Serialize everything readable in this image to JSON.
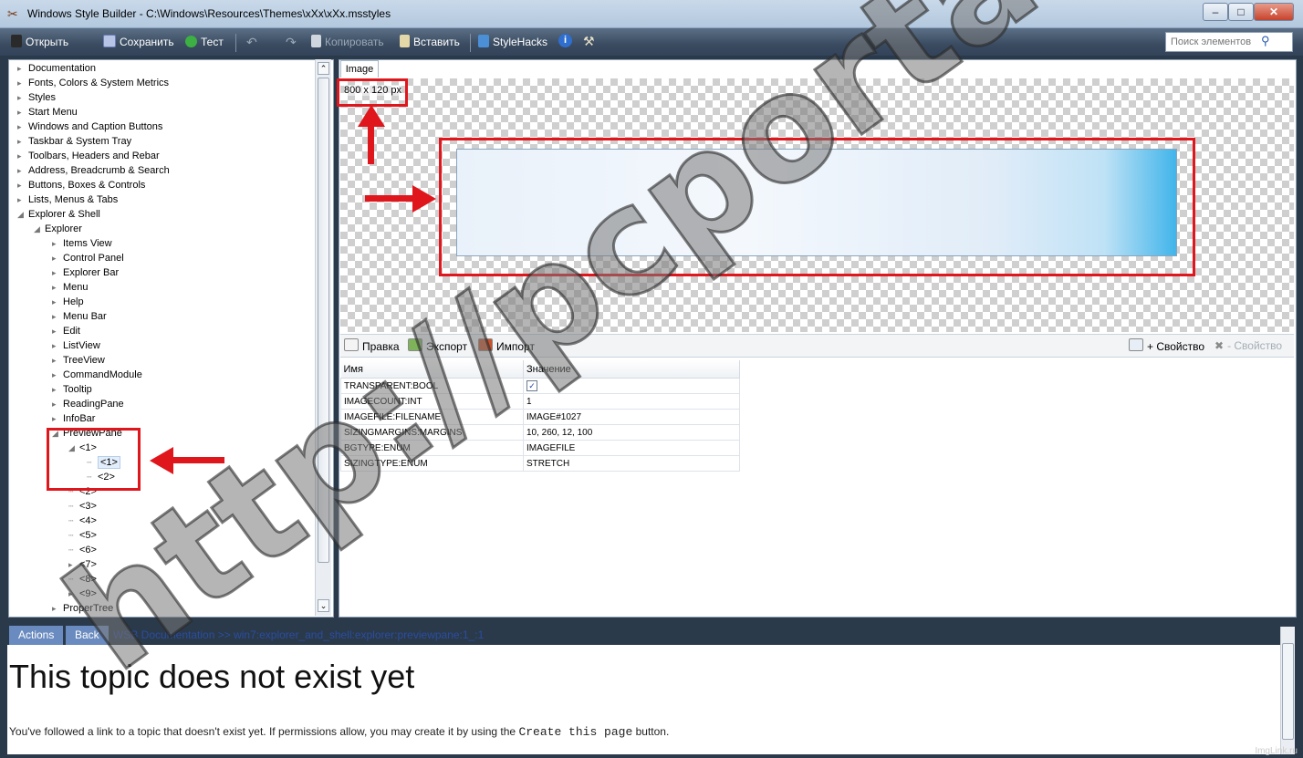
{
  "window": {
    "title": "Windows Style Builder - C:\\Windows\\Resources\\Themes\\xXx\\xXx.msstyles"
  },
  "toolbar": {
    "open": "Открыть",
    "save": "Сохранить",
    "test": "Тест",
    "copy": "Копировать",
    "paste": "Вставить",
    "stylehacks": "StyleHacks"
  },
  "search": {
    "placeholder": "Поиск элементов"
  },
  "tree": {
    "top": [
      "Documentation",
      "Fonts, Colors & System Metrics",
      "Styles",
      "Start Menu",
      "Windows and Caption Buttons",
      "Taskbar & System Tray",
      "Toolbars, Headers and Rebar",
      "Address, Breadcrumb & Search",
      "Buttons, Boxes & Controls",
      "Lists, Menus & Tabs",
      "Explorer & Shell"
    ],
    "explorer": "Explorer",
    "explorer_children": [
      "Items View",
      "Control Panel",
      "Explorer Bar",
      "Menu",
      "Help",
      "Menu Bar",
      "Edit",
      "ListView",
      "TreeView",
      "CommandModule",
      "Tooltip",
      "ReadingPane",
      "InfoBar",
      "PreviewPane"
    ],
    "preview_children": [
      "<1>",
      "<1>",
      "<2>",
      "<2>",
      "<3>",
      "<4>",
      "<5>",
      "<6>",
      "<7>",
      "<8>",
      "<9>"
    ],
    "last": "ProperTree"
  },
  "image_panel": {
    "tab": "Image",
    "size": "800 x 120 px"
  },
  "props_toolbar": {
    "edit": "Правка",
    "export": "Экспорт",
    "import": "Импорт",
    "add": "+ Свойство",
    "remove": "- Свойство"
  },
  "grid": {
    "headers": [
      "Имя",
      "Значение"
    ],
    "rows": [
      [
        "TRANSPARENT:BOOL",
        "✓"
      ],
      [
        "IMAGECOUNT:INT",
        "1"
      ],
      [
        "IMAGEFILE:FILENAME",
        "IMAGE#1027"
      ],
      [
        "SIZINGMARGINS:MARGINS",
        "10, 260, 12, 100"
      ],
      [
        "BGTYPE:ENUM",
        "IMAGEFILE"
      ],
      [
        "SIZINGTYPE:ENUM",
        "STRETCH"
      ]
    ]
  },
  "doc": {
    "actions": "Actions",
    "back": "Back",
    "crumb_root": "WSB Documentation",
    "crumb_sep": " >> ",
    "crumb_path": "win7:explorer_and_shell:explorer:previewpane:1_:1",
    "title": "This topic does not exist yet",
    "text_before": "You've followed a link to a topic that doesn't exist yet. If permissions allow, you may create it by using the ",
    "text_code": "Create this page",
    "text_after": " button."
  },
  "watermark": "http://pcportal.org.ru",
  "imglink": "ImgLink.ru"
}
